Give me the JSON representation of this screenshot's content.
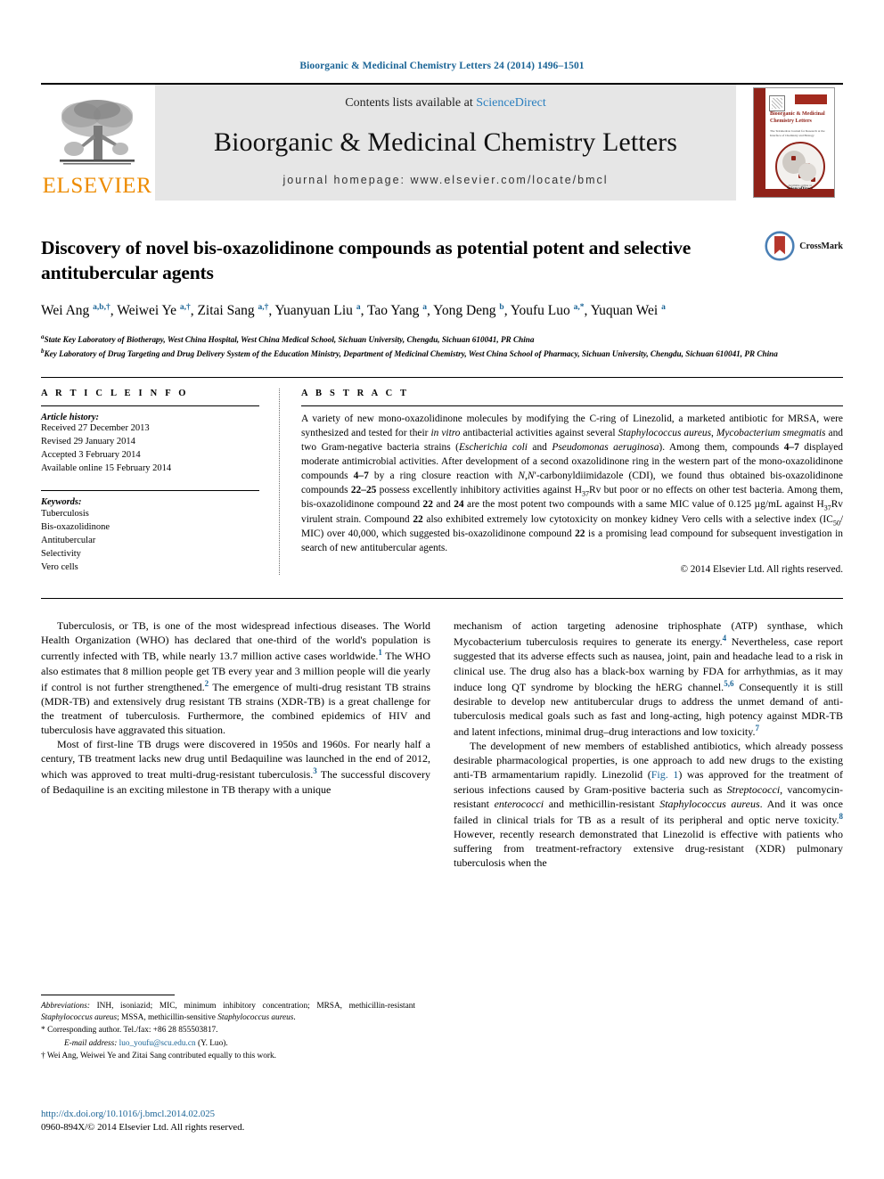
{
  "running_head": "Bioorganic & Medicinal Chemistry Letters 24 (2014) 1496–1501",
  "masthead": {
    "contents_prefix": "Contents lists available at ",
    "sciencedirect": "ScienceDirect",
    "journal_title": "Bioorganic & Medicinal Chemistry Letters",
    "homepage": "journal homepage: www.elsevier.com/locate/bmcl",
    "publisher_logo_text": "ELSEVIER",
    "cover": {
      "title": "Bioorganic & Medicinal Chemistry Letters",
      "subtitle": "The Tetrahedron Journal for Research at the Interface of Chemistry and Biology",
      "footer_small": "Available online at",
      "footer_brand": "ScienceDirect"
    }
  },
  "article": {
    "title": "Discovery of novel bis-oxazolidinone compounds as potential potent and selective antitubercular agents",
    "crossmark_label": "CrossMark",
    "authors_html": "Wei Ang <sup>a,b,†</sup>, Weiwei Ye <sup>a,†</sup>, Zitai Sang <sup>a,†</sup>, Yuanyuan Liu <sup>a</sup>, Tao Yang <sup>a</sup>, Yong Deng <sup>b</sup>, Youfu Luo <sup>a,*</sup>, Yuquan Wei <sup>a</sup>",
    "affiliation_a": "State Key Laboratory of Biotherapy, West China Hospital, West China Medical School, Sichuan University, Chengdu, Sichuan 610041, PR China",
    "affiliation_b": "Key Laboratory of Drug Targeting and Drug Delivery System of the Education Ministry, Department of Medicinal Chemistry, West China School of Pharmacy, Sichuan University, Chengdu, Sichuan 610041, PR China"
  },
  "article_info": {
    "heading": "A R T I C L E    I N F O",
    "history_label": "Article history:",
    "history": [
      "Received 27 December 2013",
      "Revised 29 January 2014",
      "Accepted 3 February 2014",
      "Available online 15 February 2014"
    ],
    "keywords_label": "Keywords:",
    "keywords": [
      "Tuberculosis",
      "Bis-oxazolidinone",
      "Antitubercular",
      "Selectivity",
      "Vero cells"
    ]
  },
  "abstract": {
    "heading": "A B S T R A C T",
    "body_html": "A variety of new mono-oxazolidinone molecules by modifying the C-ring of Linezolid, a marketed antibiotic for MRSA, were synthesized and tested for their <i>in vitro</i> antibacterial activities against several <i>Staphylococcus aureus</i>, <i>Mycobacterium smegmatis</i> and two Gram-negative bacteria strains (<i>Escherichia coli</i> and <i>Pseudomonas aeruginosa</i>). Among them, compounds <b>4–7</b> displayed moderate antimicrobial activities. After development of a second oxazolidinone ring in the western part of the mono-oxazolidinone compounds <b>4–7</b> by a ring closure reaction with <i>N</i>,<i>N</i>′-carbonyldiimidazole (CDI), we found thus obtained bis-oxazolidinone compounds <b>22–25</b> possess excellently inhibitory activities against H<sub>37</sub>Rv but poor or no effects on other test bacteria. Among them, bis-oxazolidinone compound <b>22</b> and <b>24</b> are the most potent two compounds with a same MIC value of 0.125 µg/mL against H<sub>37</sub>Rv virulent strain. Compound <b>22</b> also exhibited extremely low cytotoxicity on monkey kidney Vero cells with a selective index (IC<sub>50</sub>/ MIC) over 40,000, which suggested bis-oxazolidinone compound <b>22</b> is a promising lead compound for subsequent investigation in search of new antitubercular agents.",
    "copyright": "© 2014 Elsevier Ltd. All rights reserved."
  },
  "body": {
    "left_paragraphs_html": [
      "Tuberculosis, or TB, is one of the most widespread infectious diseases. The World Health Organization (WHO) has declared that one-third of the world's population is currently infected with TB, while nearly 13.7 million active cases worldwide.<sup class=\"ref\">1</sup> The WHO also estimates that 8 million people get TB every year and 3 million people will die yearly if control is not further strengthened.<sup class=\"ref\">2</sup> The emergence of multi-drug resistant TB strains (MDR-TB) and extensively drug resistant TB strains (XDR-TB) is a great challenge for the treatment of tuberculosis. Furthermore, the combined epidemics of HIV and tuberculosis have aggravated this situation.",
      "Most of first-line TB drugs were discovered in 1950s and 1960s. For nearly half a century, TB treatment lacks new drug until Bedaquiline was launched in the end of 2012, which was approved to treat multi-drug-resistant tuberculosis.<sup class=\"ref\">3</sup> The successful discovery of Bedaquiline is an exciting milestone in TB therapy with a unique"
    ],
    "right_paragraphs_html": [
      "mechanism of action targeting adenosine triphosphate (ATP) synthase, which Mycobacterium tuberculosis requires to generate its energy.<sup class=\"ref\">4</sup> Nevertheless, case report suggested that its adverse effects such as nausea, joint, pain and headache lead to a risk in clinical use. The drug also has a black-box warning by FDA for arrhythmias, as it may induce long QT syndrome by blocking the hERG channel.<sup class=\"ref\">5,6</sup> Consequently it is still desirable to develop new antitubercular drugs to address the unmet demand of anti-tuberculosis medical goals such as fast and long-acting, high potency against MDR-TB and latent infections, minimal drug–drug interactions and low toxicity.<sup class=\"ref\">7</sup>",
      "The development of new members of established antibiotics, which already possess desirable pharmacological properties, is one approach to add new drugs to the existing anti-TB armamentarium rapidly. Linezolid (<span class=\"lnk\">Fig. 1</span>) was approved for the treatment of serious infections caused by Gram-positive bacteria such as <i>Streptococci</i>, vancomycin-resistant <i>enterococci</i> and methicillin-resistant <i>Staphylococcus aureus</i>. And it was once failed in clinical trials for TB as a result of its peripheral and optic nerve toxicity.<sup class=\"ref\">8</sup> However, recently research demonstrated that Linezolid is effective with patients who suffering from treatment-refractory extensive drug-resistant (XDR) pulmonary tuberculosis when the"
    ]
  },
  "footnotes": {
    "abbreviations_html": "<i>Abbreviations:</i> INH, isoniazid; MIC, minimum inhibitory concentration; MRSA, methicillin-resistant <i>Staphylococcus aureus</i>; MSSA, methicillin-sensitive <i>Staphylococcus aureus</i>.",
    "corresponding_html": "<span class=\"fn-mark\">*</span> Corresponding author. Tel./fax: +86 28 855503817.",
    "email_html": "<i>E-mail address:</i> <a href=\"#\">luo_youfu@scu.edu.cn</a> (Y. Luo).",
    "equal_contrib_html": "<span class=\"fn-mark\">†</span> Wei Ang, Weiwei Ye and Zitai Sang contributed equally to this work.",
    "doi": "http://dx.doi.org/10.1016/j.bmcl.2014.02.025",
    "issn": "0960-894X/© 2014 Elsevier Ltd. All rights reserved."
  },
  "colors": {
    "link_blue": "#1a6496",
    "elsevier_orange": "#ED8B00",
    "cover_red": "#8f2219",
    "masthead_gray": "#e6e6e6"
  }
}
